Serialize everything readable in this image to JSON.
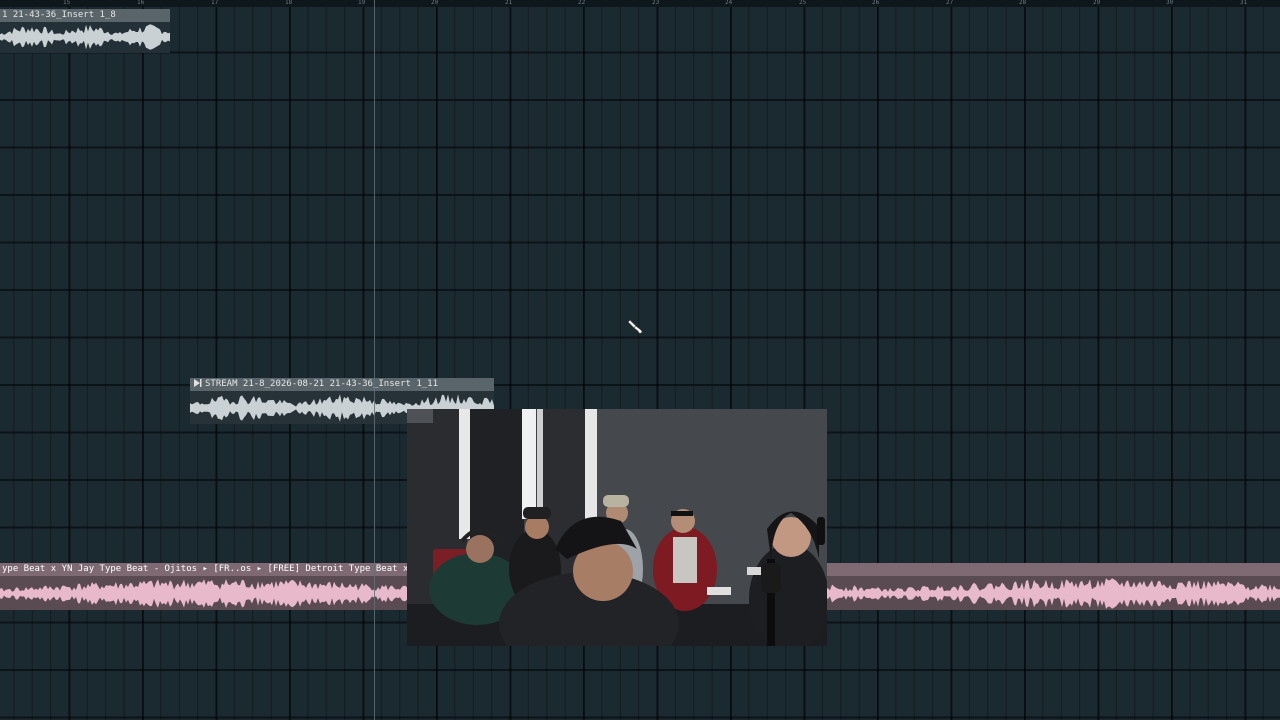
{
  "ruler": {
    "ticks": [
      "15",
      "16",
      "17",
      "18",
      "19",
      "20",
      "21",
      "22",
      "23",
      "24",
      "25",
      "26",
      "27",
      "28",
      "29",
      "30",
      "31"
    ]
  },
  "clips": {
    "clip1": {
      "title": "1 21-43-36_Insert 1_8"
    },
    "clip2": {
      "title": "STREAM 21-8_2026-08-21 21-43-36_Insert 1_11"
    },
    "clip3": {
      "title": "ype Beat x YN Jay Type Beat - Ojitos ▸ [FR..os ▸ [FREE] Detroit Type Beat x YN Jay Type"
    }
  },
  "colors": {
    "grid_bg": "#1b2930",
    "audio_clip_header": "#5a656b",
    "audio_wave": "#c9d1d4",
    "beat_clip_header": "#7f6a74",
    "beat_wave": "#e7b9cb"
  },
  "icons": {
    "cursor": "paint-brush-cursor-icon",
    "clip_marker": "play-triangle-icon"
  }
}
